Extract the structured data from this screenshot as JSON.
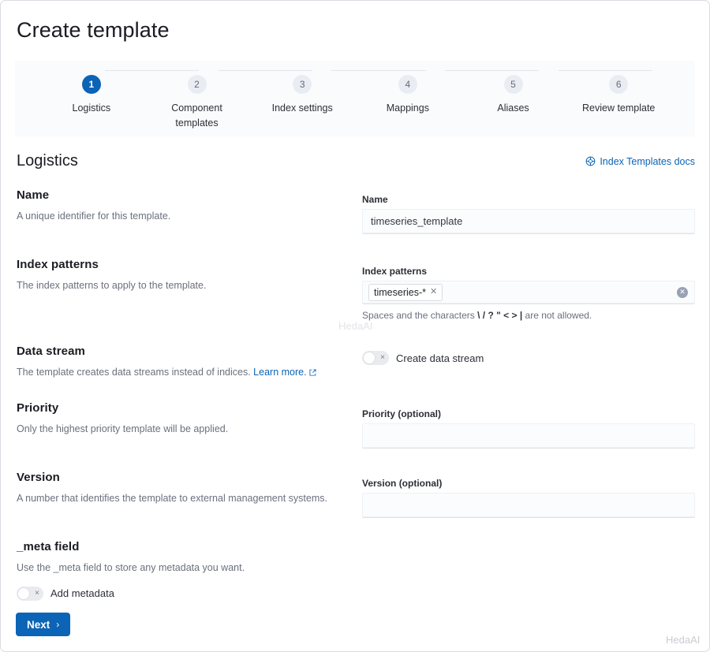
{
  "page": {
    "title": "Create template"
  },
  "stepper": {
    "steps": [
      {
        "number": "1",
        "label": "Logistics",
        "active": true
      },
      {
        "number": "2",
        "label": "Component templates",
        "active": false
      },
      {
        "number": "3",
        "label": "Index settings",
        "active": false
      },
      {
        "number": "4",
        "label": "Mappings",
        "active": false
      },
      {
        "number": "5",
        "label": "Aliases",
        "active": false
      },
      {
        "number": "6",
        "label": "Review template",
        "active": false
      }
    ]
  },
  "section": {
    "title": "Logistics",
    "docs_link": "Index Templates docs",
    "docs_icon": "help-circle-icon"
  },
  "rows": {
    "name": {
      "title": "Name",
      "description": "A unique identifier for this template.",
      "field_label": "Name",
      "value": "timeseries_template"
    },
    "index_patterns": {
      "title": "Index patterns",
      "description": "The index patterns to apply to the template.",
      "field_label": "Index patterns",
      "pill": "timeseries-*",
      "pill_remove_icon": "close-icon",
      "clear_icon": "clear-circle-icon",
      "helper_prefix": "Spaces and the characters",
      "helper_chars": "\\ / ? \" < > |",
      "helper_suffix": "are not allowed."
    },
    "data_stream": {
      "title": "Data stream",
      "description": "The template creates data streams instead of indices.",
      "learn_more": "Learn more.",
      "learn_more_icon": "external-link-icon",
      "toggle_label": "Create data stream",
      "toggle_state": "off",
      "toggle_mark": "×"
    },
    "priority": {
      "title": "Priority",
      "description": "Only the highest priority template will be applied.",
      "field_label": "Priority (optional)",
      "value": ""
    },
    "version": {
      "title": "Version",
      "description": "A number that identifies the template to external management systems.",
      "field_label": "Version (optional)",
      "value": ""
    },
    "meta_field": {
      "title": "_meta field",
      "description": "Use the _meta field to store any metadata you want.",
      "toggle_label": "Add metadata",
      "toggle_state": "off",
      "toggle_mark": "×"
    }
  },
  "footer": {
    "next_label": "Next",
    "next_chevron": "›"
  },
  "watermarks": {
    "middle": "HedaAI",
    "bottom": "HedaAI"
  },
  "colors": {
    "accent": "#0b64b5",
    "link": "#0b64b5",
    "text": "#1a1c21",
    "muted": "#6a707c",
    "step_inactive_bg": "#e9edf3",
    "panel_bg": "#fafbfd"
  }
}
